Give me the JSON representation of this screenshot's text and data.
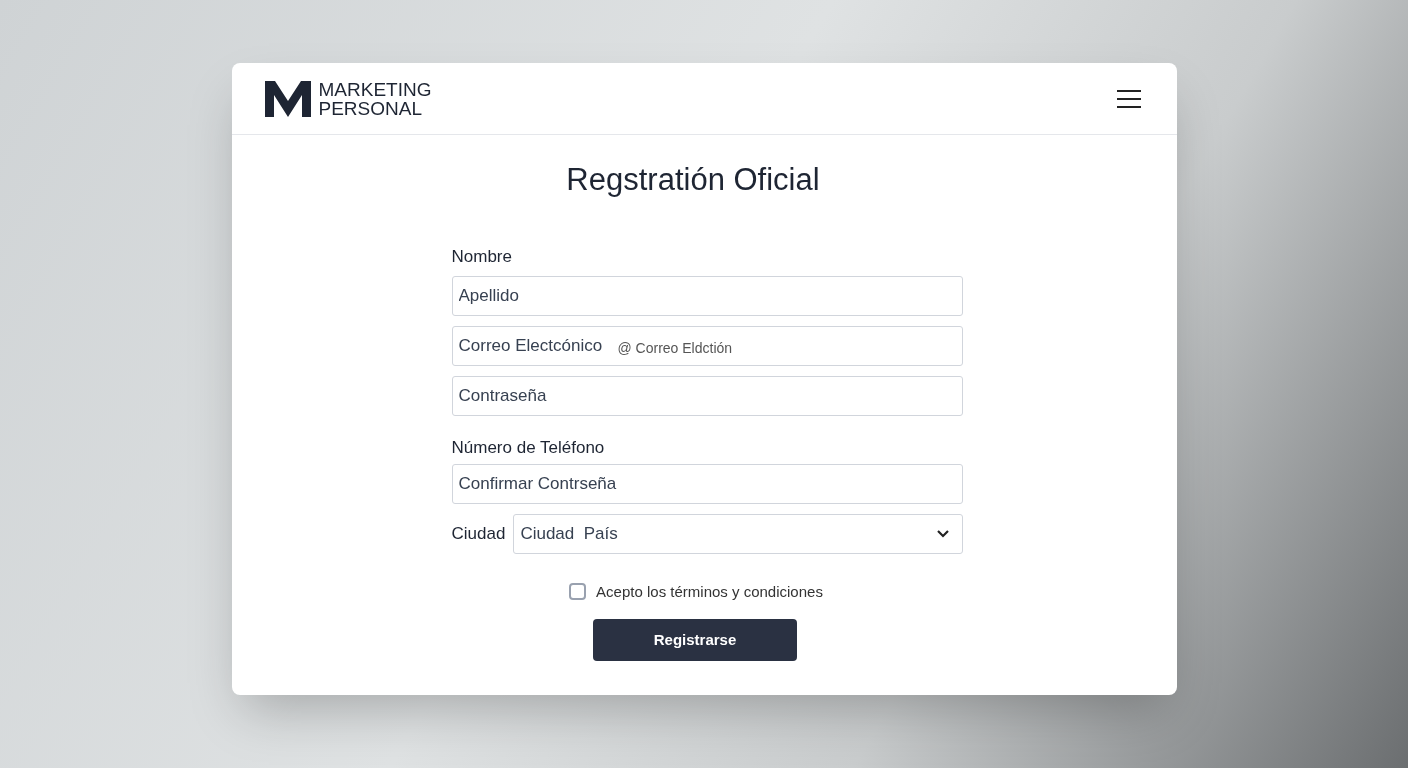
{
  "header": {
    "logo": {
      "line_1": "MARKETING",
      "line_2": "PERSONAL"
    }
  },
  "title": "Regstratión Oficial",
  "form": {
    "items": [
      {
        "kind": "label",
        "text": "Nombre"
      },
      {
        "kind": "field",
        "placeholder": "Apellido"
      },
      {
        "kind": "field",
        "placeholder": "Correo Electcónico",
        "hint": "@ Correo Eldctión"
      },
      {
        "kind": "field",
        "placeholder": "Contraseña"
      },
      {
        "kind": "label",
        "text": "Número de Teléfono"
      },
      {
        "kind": "field",
        "placeholder": "Confirmar Contrseña"
      },
      {
        "kind": "select",
        "label": "Ciudad",
        "value": "Ciudad  País"
      }
    ]
  },
  "terms": {
    "label": "Acepto los términos y condiciones",
    "checked": false
  },
  "submit": "Registrarse"
}
